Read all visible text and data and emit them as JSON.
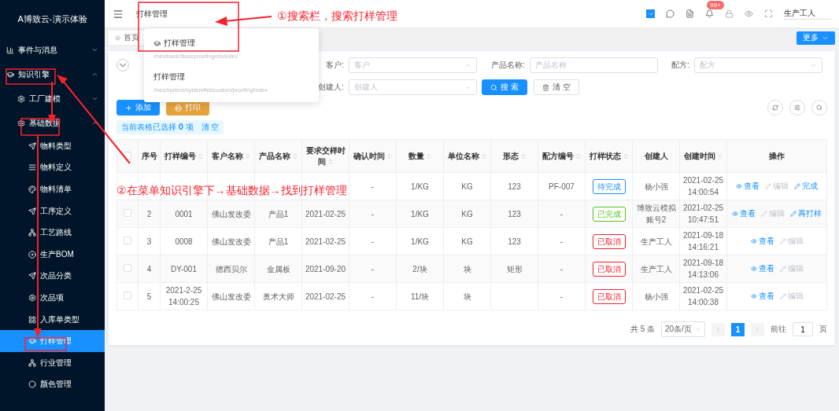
{
  "sidebar": {
    "title": "A博致云-演示体验",
    "menu": [
      {
        "label": "事件与消息",
        "expanded": false,
        "selected": false
      },
      {
        "label": "知识引擎",
        "expanded": true,
        "selected": false,
        "children": [
          {
            "label": "工厂建模",
            "expanded": false,
            "selected": false
          },
          {
            "label": "基础数据",
            "expanded": true,
            "selected": false,
            "children": [
              {
                "label": "物料类型",
                "selected": false
              },
              {
                "label": "物料定义",
                "selected": false
              },
              {
                "label": "物料清单",
                "selected": false
              },
              {
                "label": "工序定义",
                "selected": false
              },
              {
                "label": "工艺路线",
                "selected": false
              },
              {
                "label": "生产BOM",
                "selected": false
              },
              {
                "label": "次品分类",
                "selected": false
              },
              {
                "label": "次品项",
                "selected": false
              },
              {
                "label": "入库单类型",
                "selected": false
              },
              {
                "label": "打样管理",
                "selected": true
              },
              {
                "label": "行业管理",
                "selected": false
              },
              {
                "label": "颜色管理",
                "selected": false
              }
            ]
          }
        ]
      }
    ]
  },
  "header": {
    "search_value": "打样管理",
    "badge": "99+",
    "user": "生产工人"
  },
  "search_results": [
    {
      "title": "打样管理",
      "path": "/mes/basic/basicproofinginfo/index"
    },
    {
      "title": "打样管理",
      "path": "/mes/system/systemfieldcustom/proofing/index"
    }
  ],
  "tabs": [
    {
      "label": "首页",
      "selected": false
    }
  ],
  "more_button": "更多",
  "filters": [
    {
      "label": "客户:",
      "placeholder": "客户",
      "kind": "select"
    },
    {
      "label": "产品名称:",
      "placeholder": "产品名称",
      "kind": "input"
    },
    {
      "label": "配方:",
      "placeholder": "配方",
      "kind": "select"
    },
    {
      "label": "创建人:",
      "placeholder": "创建人",
      "kind": "select"
    }
  ],
  "search_button": "搜 索",
  "clear_button": "清 空",
  "toolbar": {
    "add": "添加",
    "print": "打印"
  },
  "selection_info": {
    "text": "当前表格已选择 **0** 项",
    "clear": "清 空"
  },
  "table": {
    "all_checked": false,
    "columns": [
      {
        "label": "序号",
        "sortable": false
      },
      {
        "label": "打样编号",
        "sortable": true
      },
      {
        "label": "客户名称",
        "sortable": true
      },
      {
        "label": "产品名称",
        "sortable": true
      },
      {
        "label": "要求交样时间",
        "sortable": true
      },
      {
        "label": "确认时间",
        "sortable": true
      },
      {
        "label": "数量",
        "sortable": true
      },
      {
        "label": "单位名称",
        "sortable": true
      },
      {
        "label": "形态",
        "sortable": true
      },
      {
        "label": "配方编号",
        "sortable": true
      },
      {
        "label": "打样状态",
        "sortable": true
      },
      {
        "label": "创建人",
        "sortable": false
      },
      {
        "label": "创建时间",
        "sortable": true
      },
      {
        "label": "操作",
        "sortable": false
      }
    ],
    "rows": [
      {
        "cells": [
          null,
          null,
          null,
          null,
          null,
          "-",
          "1/KG",
          "KG",
          "123",
          "PF-007"
        ],
        "status": {
          "label": "待完成",
          "color": "#1890ff"
        },
        "creator": "杨小强",
        "created": "2021-02-25 14:00:54",
        "actions": [
          {
            "label": "查看",
            "disabled": false
          },
          {
            "label": "编辑",
            "disabled": true
          },
          {
            "label": "完成",
            "disabled": false
          }
        ]
      },
      {
        "checked": false,
        "cells": [
          "2",
          "0001",
          "佛山发改委",
          "产品1",
          "2021-02-25",
          "-",
          "1/KG",
          "KG",
          "123",
          "-"
        ],
        "status": {
          "label": "已完成",
          "color": "#52c41a"
        },
        "creator": "博致云模拟账号2",
        "created": "2021-02-25 10:47:51",
        "actions": [
          {
            "label": "查看",
            "disabled": false
          },
          {
            "label": "编辑",
            "disabled": true
          },
          {
            "label": "再打样",
            "disabled": false
          }
        ]
      },
      {
        "checked": false,
        "cells": [
          "3",
          "0008",
          "佛山发改委",
          "产品1",
          "2021-02-25",
          "-",
          "1/KG",
          "KG",
          "123",
          "-"
        ],
        "status": {
          "label": "已取消",
          "color": "#f5222d"
        },
        "creator": "生产工人",
        "created": "2021-09-18 14:16:21",
        "actions": [
          {
            "label": "查看",
            "disabled": false
          },
          {
            "label": "编辑",
            "disabled": true
          }
        ]
      },
      {
        "checked": false,
        "cells": [
          "4",
          "DY-001",
          "德西贝尔",
          "金属板",
          "2021-09-20",
          "-",
          "2/块",
          "块",
          "矩形",
          "-"
        ],
        "status": {
          "label": "已取消",
          "color": "#f5222d"
        },
        "creator": "生产工人",
        "created": "2021-09-18 14:13:06",
        "actions": [
          {
            "label": "查看",
            "disabled": false
          },
          {
            "label": "编辑",
            "disabled": true
          }
        ]
      },
      {
        "checked": false,
        "cells": [
          "5",
          "2021-2-25 14:00:25",
          "佛山发改委",
          "奥术大师",
          "2021-02-25",
          "-",
          "11/块",
          "块",
          null,
          "-"
        ],
        "status": {
          "label": "已取消",
          "color": "#f5222d"
        },
        "creator": "杨小强",
        "created": "2021-02-25 14:00:38",
        "actions": [
          {
            "label": "查看",
            "disabled": false
          },
          {
            "label": "编辑",
            "disabled": true
          }
        ]
      }
    ]
  },
  "pagination": {
    "total": "共 5 条",
    "page_size": "20条/页",
    "pages": [
      {
        "label": "1",
        "selected": true
      }
    ],
    "goto_label": "前往",
    "goto_value": "1",
    "goto_unit": "页"
  },
  "annotations": [
    {
      "text": "①搜索栏，搜索打样管理"
    },
    {
      "text": "②在菜单知识引擎下→基础数据→找到打样管理"
    }
  ]
}
